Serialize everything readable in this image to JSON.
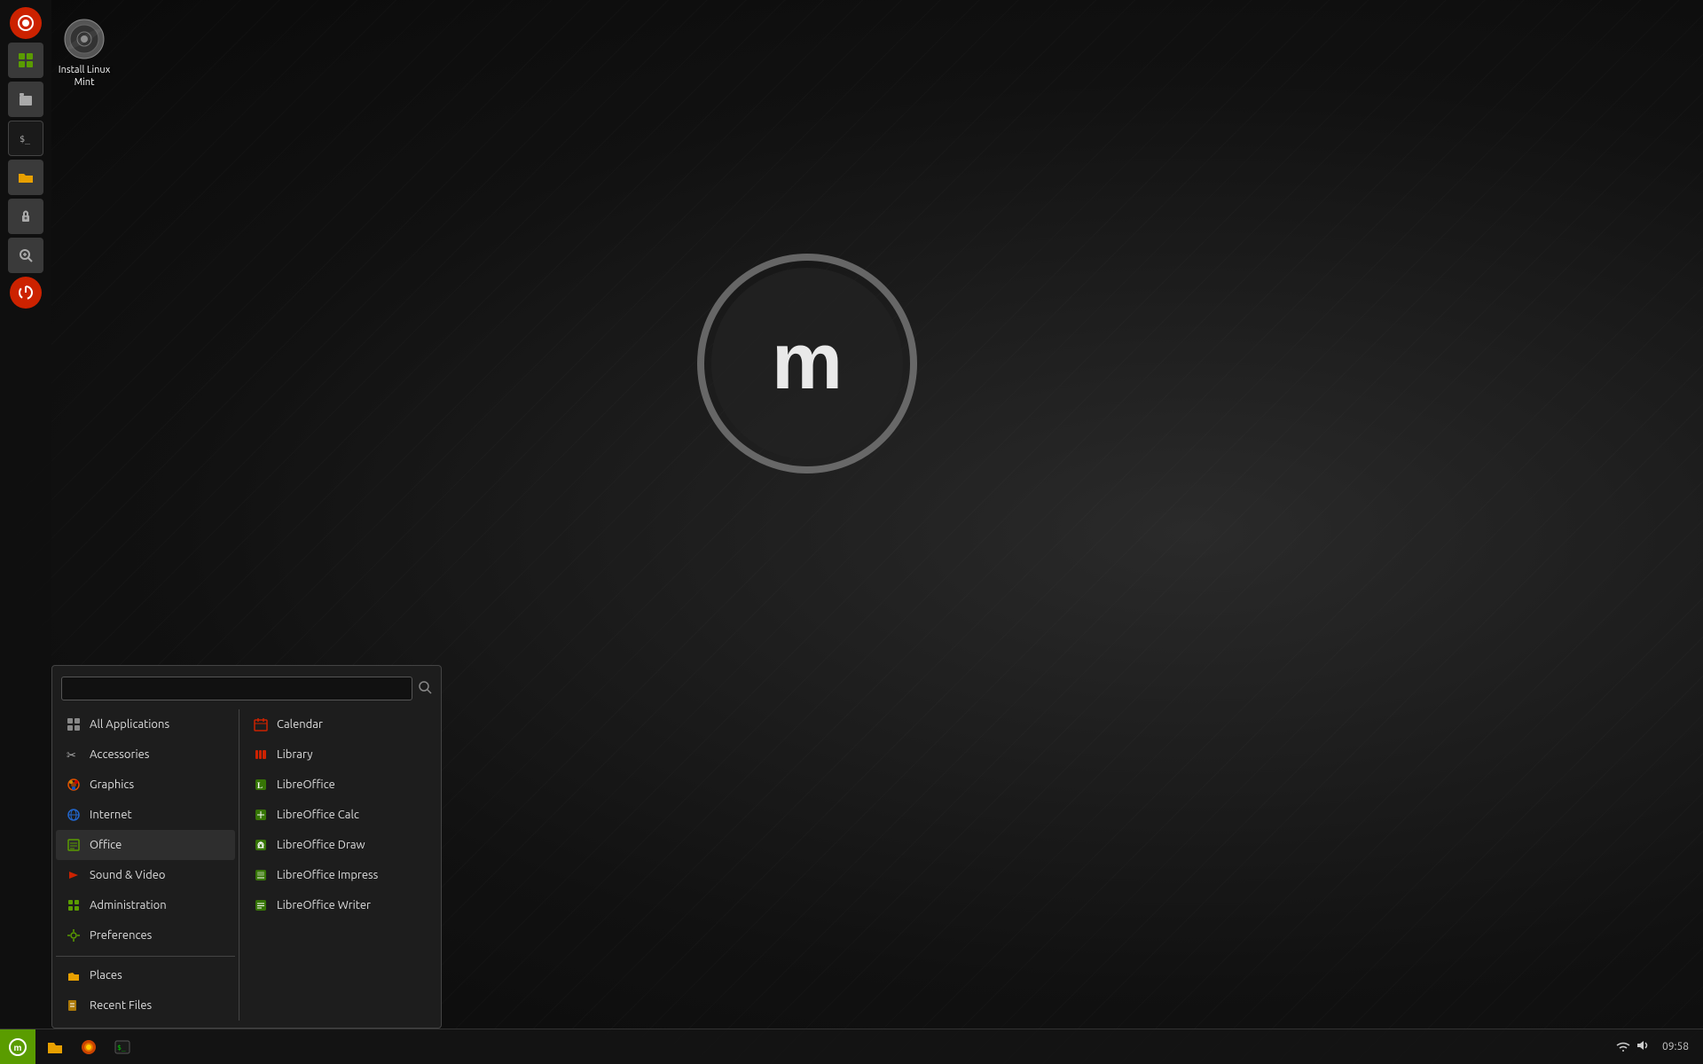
{
  "desktop": {
    "background_color": "#1a1a1a"
  },
  "desktop_icons": [
    {
      "id": "install-linux-mint",
      "label": "Install Linux Mint",
      "icon_type": "disc"
    }
  ],
  "taskbar": {
    "start_button_label": "Menu",
    "app_icons": [
      {
        "id": "files",
        "unicode": "📁",
        "label": "Files"
      },
      {
        "id": "firefox",
        "unicode": "🦊",
        "label": "Firefox"
      },
      {
        "id": "terminal",
        "unicode": "⬛",
        "label": "Terminal"
      }
    ],
    "system_tray": {
      "network_icon": "🔌",
      "volume_icon": "🔊",
      "time": "09:58"
    }
  },
  "sidebar": {
    "icons": [
      {
        "id": "hypnotix",
        "unicode": "📺",
        "color": "#cc2200"
      },
      {
        "id": "calculator",
        "unicode": "🔢",
        "color": "#5a9c00"
      },
      {
        "id": "files-sidebar",
        "unicode": "📋",
        "color": "#aaa"
      },
      {
        "id": "terminal-sidebar",
        "unicode": "⬛",
        "color": "#333"
      },
      {
        "id": "folder",
        "unicode": "📁",
        "color": "#e8a000"
      },
      {
        "id": "lock",
        "unicode": "🔒",
        "color": "#aaa"
      },
      {
        "id": "search",
        "unicode": "🔍",
        "color": "#aaa"
      },
      {
        "id": "power",
        "unicode": "⏻",
        "color": "#cc2200"
      }
    ]
  },
  "menu": {
    "search_placeholder": "",
    "categories": [
      {
        "id": "all-applications",
        "label": "All Applications",
        "icon_type": "grid",
        "icon_color": "#888"
      },
      {
        "id": "accessories",
        "label": "Accessories",
        "icon_type": "wrench",
        "icon_color": "#aaa"
      },
      {
        "id": "graphics",
        "label": "Graphics",
        "icon_type": "graphics",
        "icon_color": "#e05000"
      },
      {
        "id": "internet",
        "label": "Internet",
        "icon_type": "internet",
        "icon_color": "#2266cc"
      },
      {
        "id": "office",
        "label": "Office",
        "icon_type": "office",
        "icon_color": "#5a9c00",
        "active": true
      },
      {
        "id": "sound-video",
        "label": "Sound & Video",
        "icon_type": "media",
        "icon_color": "#cc2200"
      },
      {
        "id": "administration",
        "label": "Administration",
        "icon_type": "admin",
        "icon_color": "#5a9c00"
      },
      {
        "id": "preferences",
        "label": "Preferences",
        "icon_type": "prefs",
        "icon_color": "#5a9c00"
      }
    ],
    "bottom_items": [
      {
        "id": "places",
        "label": "Places",
        "icon_type": "folder",
        "icon_color": "#e8a000"
      },
      {
        "id": "recent-files",
        "label": "Recent Files",
        "icon_type": "recent",
        "icon_color": "#e8a000"
      }
    ],
    "apps": [
      {
        "id": "calendar",
        "label": "Calendar",
        "icon_type": "calendar",
        "icon_color": "#cc2200"
      },
      {
        "id": "library",
        "label": "Library",
        "icon_type": "library",
        "icon_color": "#cc2200"
      },
      {
        "id": "libreoffice",
        "label": "LibreOffice",
        "icon_type": "libreoffice",
        "icon_color": "#3d8c00"
      },
      {
        "id": "libreoffice-calc",
        "label": "LibreOffice Calc",
        "icon_type": "calc",
        "icon_color": "#3d8c00"
      },
      {
        "id": "libreoffice-draw",
        "label": "LibreOffice Draw",
        "icon_type": "draw",
        "icon_color": "#3d8c00"
      },
      {
        "id": "libreoffice-impress",
        "label": "LibreOffice Impress",
        "icon_type": "impress",
        "icon_color": "#3d8c00"
      },
      {
        "id": "libreoffice-writer",
        "label": "LibreOffice Writer",
        "icon_type": "writer",
        "icon_color": "#3d8c00"
      }
    ]
  }
}
